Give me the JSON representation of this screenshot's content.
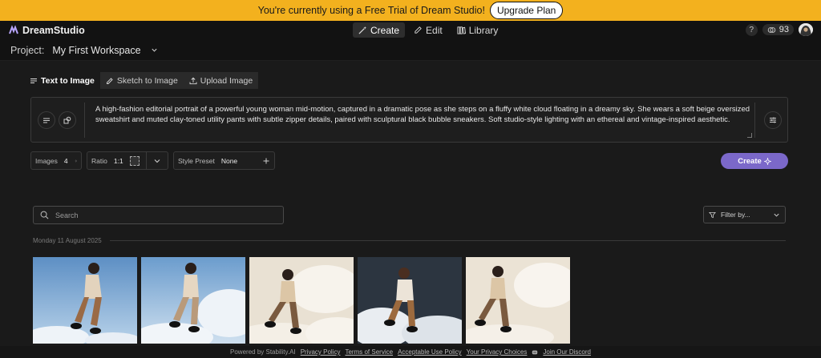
{
  "banner": {
    "message": "You're currently using a Free Trial of Dream Studio!",
    "upgrade_label": "Upgrade Plan",
    "color": "#f3b11e"
  },
  "app": {
    "name": "DreamStudio",
    "logo_icon": "dreamstudio-logo-icon"
  },
  "nav": {
    "items": [
      {
        "label": "Create",
        "icon": "wand-icon",
        "active": true
      },
      {
        "label": "Edit",
        "icon": "pencil-icon",
        "active": false
      },
      {
        "label": "Library",
        "icon": "books-icon",
        "active": false
      }
    ]
  },
  "account": {
    "help_label": "?",
    "credits": "93",
    "credits_icon": "coins-icon"
  },
  "project": {
    "label": "Project:",
    "workspace": "My First Workspace"
  },
  "tabs": [
    {
      "label": "Text to Image",
      "icon": "lines-icon",
      "active": true
    },
    {
      "label": "Sketch to Image",
      "icon": "pencil-icon",
      "active": false
    },
    {
      "label": "Upload Image",
      "icon": "upload-icon",
      "active": false
    }
  ],
  "prompt": {
    "text": "A high-fashion editorial portrait of a powerful young woman mid-motion, captured in a dramatic pose as she steps on a fluffy white cloud floating in a dreamy sky. She wears a soft beige oversized sweatshirt and muted clay-toned utility pants with subtle zipper details, paired with sculptural black bubble sneakers. Soft studio-style lighting with an ethereal and vintage-inspired aesthetic."
  },
  "controls": {
    "images_label": "Images",
    "images_value": "4",
    "ratio_label": "Ratio",
    "ratio_value": "1:1",
    "style_label": "Style Preset",
    "style_value": "None",
    "create_label": "Create",
    "create_color": "#7b68c9"
  },
  "search": {
    "placeholder": "Search"
  },
  "filter": {
    "label": "Filter by..."
  },
  "gallery": {
    "date": "Monday 11 August 2025",
    "images": [
      {
        "scene": "blue-sky"
      },
      {
        "scene": "blue-sky-clouds"
      },
      {
        "scene": "cream-clouds"
      },
      {
        "scene": "dark-sky"
      },
      {
        "scene": "cream-clouds"
      }
    ]
  },
  "footer": {
    "powered": "Powered by Stability.AI",
    "links": [
      "Privacy Policy",
      "Terms of Service",
      "Acceptable Use Policy",
      "Your Privacy Choices"
    ],
    "discord": "Join Our Discord"
  }
}
